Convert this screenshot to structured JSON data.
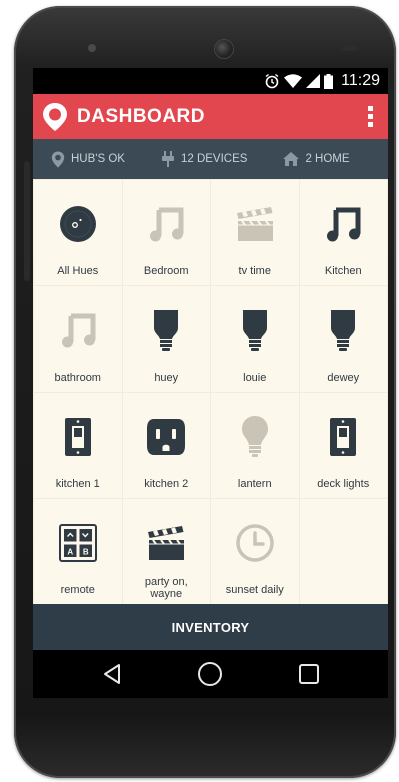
{
  "statusbar": {
    "time": "11:29"
  },
  "appbar": {
    "title": "DASHBOARD"
  },
  "info": {
    "hub": "HUB'S OK",
    "devices": "12 DEVICES",
    "home": "2 HOME"
  },
  "tiles": [
    {
      "label": "All Hues",
      "icon": "all-hues-icon"
    },
    {
      "label": "Bedroom",
      "icon": "music-note-icon"
    },
    {
      "label": "tv time",
      "icon": "clapperboard-icon"
    },
    {
      "label": "Kitchen",
      "icon": "music-note-icon"
    },
    {
      "label": "bathroom",
      "icon": "music-note-icon"
    },
    {
      "label": "huey",
      "icon": "bulb-icon"
    },
    {
      "label": "louie",
      "icon": "bulb-icon"
    },
    {
      "label": "dewey",
      "icon": "bulb-icon"
    },
    {
      "label": "kitchen 1",
      "icon": "switch-icon"
    },
    {
      "label": "kitchen 2",
      "icon": "outlet-icon"
    },
    {
      "label": "lantern",
      "icon": "lightbulb-icon"
    },
    {
      "label": "deck lights",
      "icon": "switch-icon"
    },
    {
      "label": "remote",
      "icon": "remote-icon"
    },
    {
      "label": "party on, wayne",
      "icon": "clapperboard-icon"
    },
    {
      "label": "sunset daily",
      "icon": "clock-icon"
    }
  ],
  "bottom": {
    "inventory": "INVENTORY"
  },
  "colors": {
    "accent": "#e2474f",
    "dark": "#2f3d48",
    "info_bar": "#3b4a55",
    "tile_bg": "#fdf8ec",
    "muted_icon": "#c9c4b6"
  }
}
